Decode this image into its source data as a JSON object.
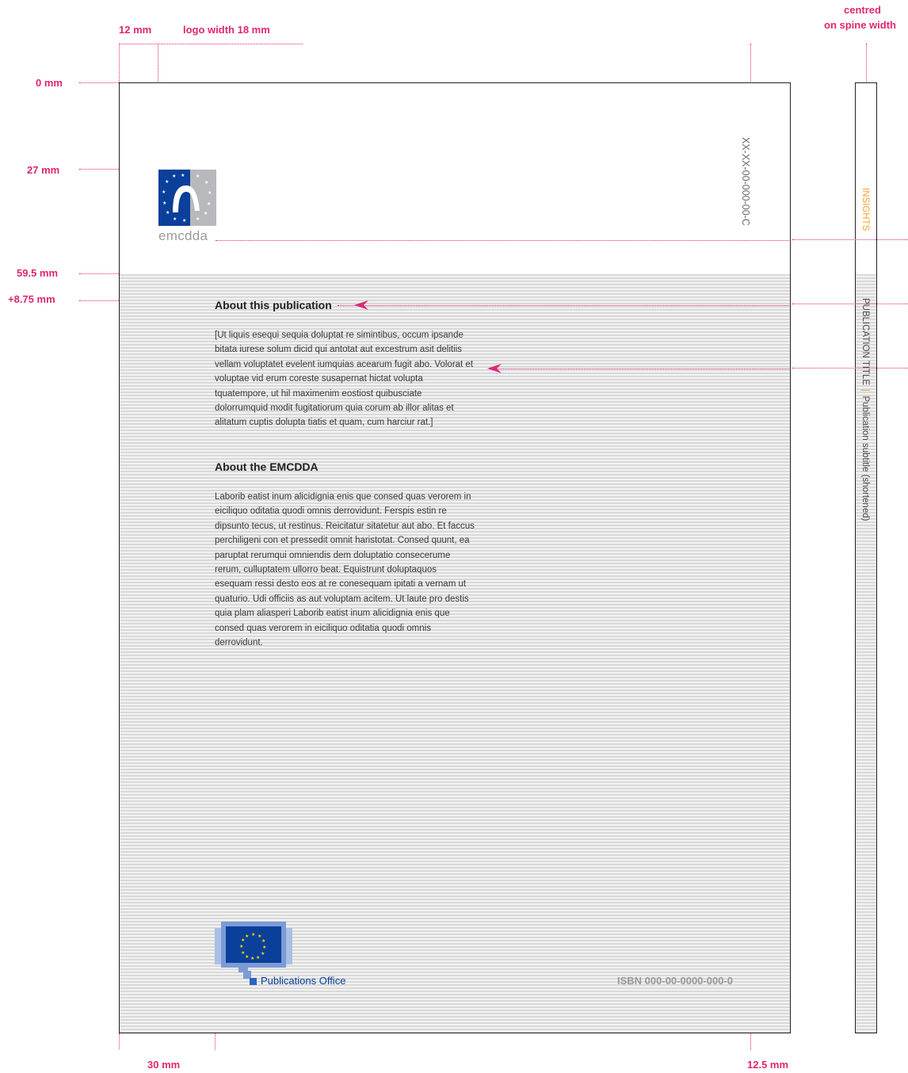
{
  "measurements": {
    "left_margin": "12 mm",
    "logo_width": "logo width 18 mm",
    "top": "0 mm",
    "logo_top": "27 mm",
    "band_top": "59.5 mm",
    "text_offset": "+8.75 mm",
    "bottom_left": "30 mm",
    "bottom_right": "12.5 mm",
    "spine_note_1": "centred",
    "spine_note_2": "on spine width"
  },
  "logo": {
    "wordmark": "emcdda"
  },
  "catalogue_number": "XX-XX-00-000-00-C",
  "about_publication": {
    "heading": "About this publication",
    "body": "[Ut liquis esequi sequia doluptat re simintibus, occum ipsande bitata iurese solum dicid qui antotat aut excestrum asit delitiis vellam voluptatet evelent iumquias acearum fugit abo. Volorat et voluptae vid erum coreste susapernat hictat volupta tquatempore, ut hil maximenim eostiost quibusciate dolorrumquid modit fugitatiorum quia corum ab illor alitas et alitatum cuptis dolupta tiatis et quam, cum harciur rat.]"
  },
  "about_emcdda": {
    "heading": "About the EMCDDA",
    "body": "Laborib eatist inum alicidignia enis que consed quas verorem in eiciliquo oditatia quodi omnis derrovidunt. Ferspis estin re dipsunto tecus, ut restinus. Reicitatur sitatetur aut abo. Et faccus perchiligeni con et pressedit omnit haristotat. Consed quunt, ea paruptat rerumqui omniendis dem doluptatio consecerume rerum, culluptatem ullorro beat. Equistrunt doluptaquos esequam ressi desto eos at re conesequam ipitati a vernam ut quaturio. Udi officiis as aut voluptam acitem. Ut laute pro destis quia plam aliasperi Laborib eatist inum alicidignia enis que consed quas verorem in eiciliquo oditatia quodi omnis derrovidunt."
  },
  "publisher": {
    "name": "Publications Office"
  },
  "isbn": "ISBN 000-00-0000-000-0",
  "spine": {
    "series": "INSIGHTS",
    "title": "PUBLICATION TITLE",
    "separator": "|",
    "subtitle": "Publication subtitle (shortened)"
  },
  "colors": {
    "guide": "#e0267a",
    "eu_blue": "#0a3f9a",
    "series_orange": "#f7a22c",
    "stripe_dark": "#d9d9d9",
    "stripe_light": "#f2f2f2"
  }
}
